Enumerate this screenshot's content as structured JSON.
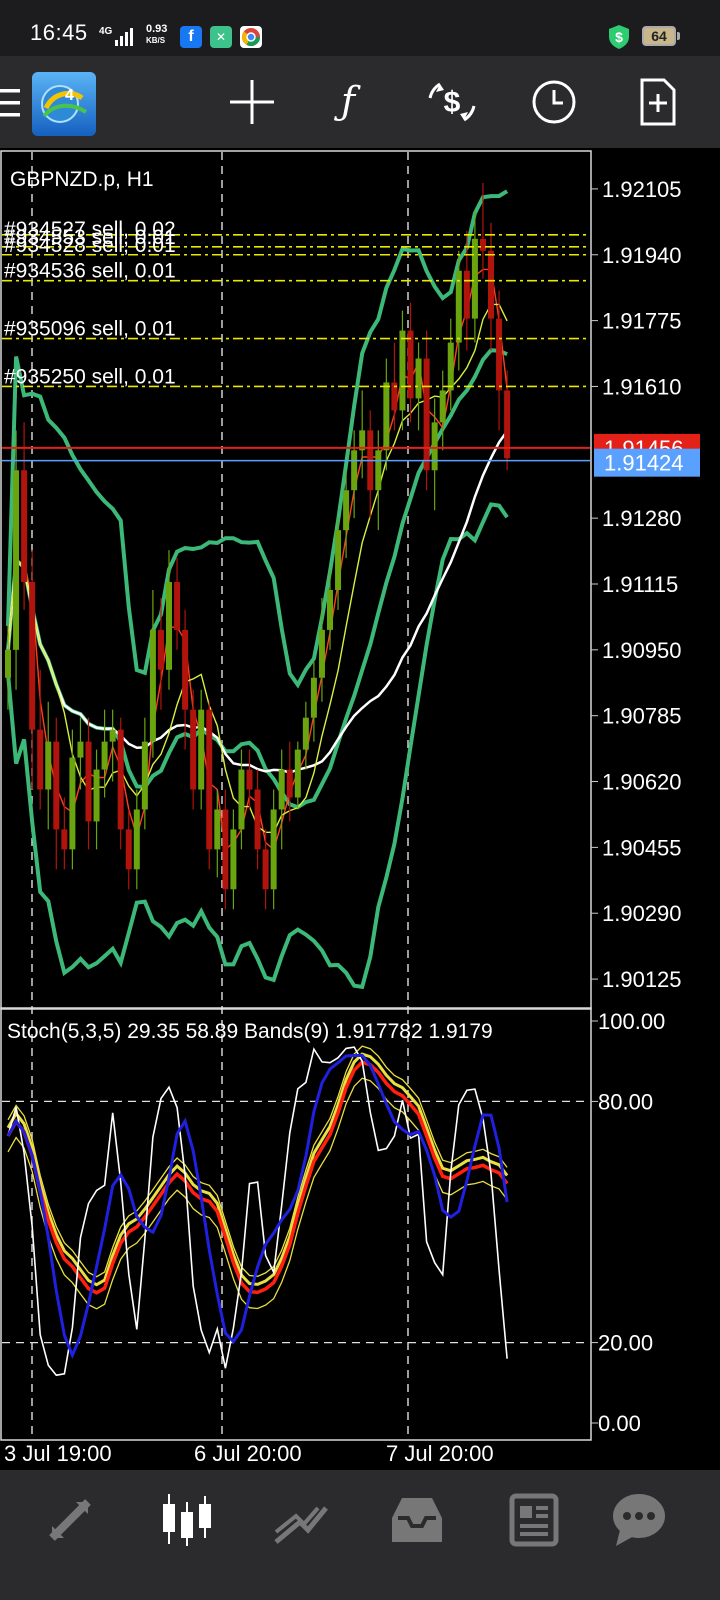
{
  "status_bar": {
    "time": "16:45",
    "network": "4G",
    "speed_value": "0.93",
    "speed_unit": "KB/S",
    "battery": "64",
    "icons": [
      "facebook-icon",
      "app-icon",
      "chrome-icon",
      "shield-dollar-icon",
      "battery-icon"
    ]
  },
  "toolbar": {
    "buttons": [
      "menu-icon",
      "mt4-logo",
      "crosshair-icon",
      "indicators-icon",
      "trade-icon",
      "timeframe-icon",
      "new-order-icon"
    ]
  },
  "chart": {
    "symbol_label": "GBPNZD.p, H1",
    "orders": [
      {
        "label": "#934527 sell, 0.02",
        "price": 1.9199
      },
      {
        "label": "#934553 sell, 0.01",
        "price": 1.9196
      },
      {
        "label": "#934528 sell, 0.01",
        "price": 1.9194
      },
      {
        "label": "#934536 sell, 0.01",
        "price": 1.91875
      },
      {
        "label": "#935096 sell, 0.01",
        "price": 1.9173
      },
      {
        "label": "#935250 sell, 0.01",
        "price": 1.9161
      }
    ],
    "bid_price_label": "1.91456",
    "ask_price_label": "1.91424",
    "bid_price": 1.91456,
    "ask_price": 1.91424,
    "colors": {
      "bid_line": "#e32119",
      "ask_line": "#5aa0ff",
      "order_line": "#e8e800",
      "bull_candle": "#6aa40f",
      "bear_candle": "#b0140c",
      "bands": "#3cb878",
      "ma_white": "#ffffff",
      "ma_red": "#ff4020",
      "ma_yellow": "#d8f040"
    },
    "price_axis": [
      "1.92105",
      "1.91940",
      "1.91775",
      "1.91610",
      "1.91280",
      "1.91115",
      "1.90950",
      "1.90785",
      "1.90620",
      "1.90455",
      "1.90290",
      "1.90125"
    ],
    "price_axis_values": [
      1.92105,
      1.9194,
      1.91775,
      1.9161,
      1.9128,
      1.91115,
      1.9095,
      1.90785,
      1.9062,
      1.90455,
      1.9029,
      1.90125
    ],
    "ylim": [
      1.9005,
      1.922
    ]
  },
  "oscillator": {
    "label": "Stoch(5,3,5) 29.35 58.89 Bands(9) 1.917782 1.9179",
    "axis": [
      "100.00",
      "80.00",
      "20.00",
      "0.00"
    ],
    "axis_values": [
      100,
      80,
      20,
      0
    ],
    "colors": {
      "main": "#ffffff",
      "signal": "#2020e0",
      "band_outer": "#e8e040",
      "band_mid": "#ff2010"
    }
  },
  "time_axis": [
    "3 Jul 19:00",
    "6 Jul 20:00",
    "7 Jul 20:00"
  ],
  "bottom_nav": {
    "items": [
      "quotes-icon",
      "chart-icon",
      "trade-icon",
      "history-icon",
      "news-icon",
      "chat-icon"
    ],
    "active": "chart-icon"
  },
  "chart_data": {
    "type": "candlestick",
    "symbol": "GBPNZD.p",
    "timeframe": "H1",
    "ylim": [
      1.9005,
      1.922
    ],
    "x_labels": [
      "3 Jul 19:00",
      "6 Jul 20:00",
      "7 Jul 20:00"
    ],
    "candles": [
      [
        1.9088,
        1.9101,
        1.908,
        1.9095
      ],
      [
        1.9095,
        1.915,
        1.9085,
        1.914
      ],
      [
        1.914,
        1.9152,
        1.9105,
        1.9112
      ],
      [
        1.9112,
        1.912,
        1.906,
        1.9075
      ],
      [
        1.9075,
        1.909,
        1.9055,
        1.906
      ],
      [
        1.906,
        1.9082,
        1.905,
        1.9072
      ],
      [
        1.9072,
        1.9078,
        1.904,
        1.905
      ],
      [
        1.905,
        1.9058,
        1.904,
        1.9045
      ],
      [
        1.9045,
        1.9075,
        1.904,
        1.9068
      ],
      [
        1.9068,
        1.9078,
        1.906,
        1.9072
      ],
      [
        1.9072,
        1.9078,
        1.9045,
        1.9052
      ],
      [
        1.9052,
        1.907,
        1.9045,
        1.9065
      ],
      [
        1.9065,
        1.908,
        1.9058,
        1.9072
      ],
      [
        1.9072,
        1.908,
        1.9062,
        1.9075
      ],
      [
        1.9075,
        1.9078,
        1.9045,
        1.905
      ],
      [
        1.905,
        1.9055,
        1.9035,
        1.904
      ],
      [
        1.904,
        1.906,
        1.9035,
        1.9055
      ],
      [
        1.9055,
        1.9078,
        1.905,
        1.9072
      ],
      [
        1.9072,
        1.911,
        1.9068,
        1.91
      ],
      [
        1.91,
        1.9108,
        1.908,
        1.909
      ],
      [
        1.909,
        1.912,
        1.9085,
        1.9112
      ],
      [
        1.9112,
        1.9118,
        1.9095,
        1.91
      ],
      [
        1.91,
        1.9105,
        1.907,
        1.908
      ],
      [
        1.908,
        1.9085,
        1.9055,
        1.906
      ],
      [
        1.906,
        1.9085,
        1.9055,
        1.908
      ],
      [
        1.908,
        1.9082,
        1.904,
        1.9045
      ],
      [
        1.9045,
        1.906,
        1.9038,
        1.9055
      ],
      [
        1.9055,
        1.906,
        1.903,
        1.9035
      ],
      [
        1.9035,
        1.9055,
        1.903,
        1.905
      ],
      [
        1.905,
        1.907,
        1.9045,
        1.9065
      ],
      [
        1.9065,
        1.907,
        1.9055,
        1.906
      ],
      [
        1.906,
        1.9065,
        1.904,
        1.9045
      ],
      [
        1.9045,
        1.905,
        1.903,
        1.9035
      ],
      [
        1.9035,
        1.906,
        1.903,
        1.9055
      ],
      [
        1.9055,
        1.907,
        1.9045,
        1.9065
      ],
      [
        1.9065,
        1.9072,
        1.9052,
        1.9058
      ],
      [
        1.9058,
        1.9072,
        1.9055,
        1.907
      ],
      [
        1.907,
        1.9082,
        1.9065,
        1.9078
      ],
      [
        1.9078,
        1.9092,
        1.9072,
        1.9088
      ],
      [
        1.9088,
        1.9108,
        1.9082,
        1.91
      ],
      [
        1.91,
        1.9115,
        1.9095,
        1.911
      ],
      [
        1.911,
        1.9128,
        1.9105,
        1.9125
      ],
      [
        1.9125,
        1.914,
        1.9118,
        1.9135
      ],
      [
        1.9135,
        1.915,
        1.9128,
        1.9145
      ],
      [
        1.9145,
        1.916,
        1.9138,
        1.915
      ],
      [
        1.915,
        1.9155,
        1.9128,
        1.9135
      ],
      [
        1.9135,
        1.915,
        1.9125,
        1.9145
      ],
      [
        1.9145,
        1.9168,
        1.914,
        1.9162
      ],
      [
        1.9162,
        1.9172,
        1.915,
        1.9155
      ],
      [
        1.9155,
        1.918,
        1.915,
        1.9175
      ],
      [
        1.9175,
        1.9182,
        1.9152,
        1.9158
      ],
      [
        1.9158,
        1.9172,
        1.915,
        1.9168
      ],
      [
        1.9168,
        1.9175,
        1.9135,
        1.914
      ],
      [
        1.914,
        1.9158,
        1.913,
        1.9152
      ],
      [
        1.9152,
        1.9165,
        1.9145,
        1.916
      ],
      [
        1.916,
        1.9178,
        1.9155,
        1.9172
      ],
      [
        1.9172,
        1.9195,
        1.9165,
        1.919
      ],
      [
        1.919,
        1.92,
        1.917,
        1.9178
      ],
      [
        1.9178,
        1.9205,
        1.9172,
        1.9198
      ],
      [
        1.9198,
        1.9212,
        1.9188,
        1.9195
      ],
      [
        1.9195,
        1.9202,
        1.917,
        1.9178
      ],
      [
        1.9178,
        1.9185,
        1.915,
        1.916
      ],
      [
        1.916,
        1.9165,
        1.914,
        1.9143
      ]
    ]
  }
}
